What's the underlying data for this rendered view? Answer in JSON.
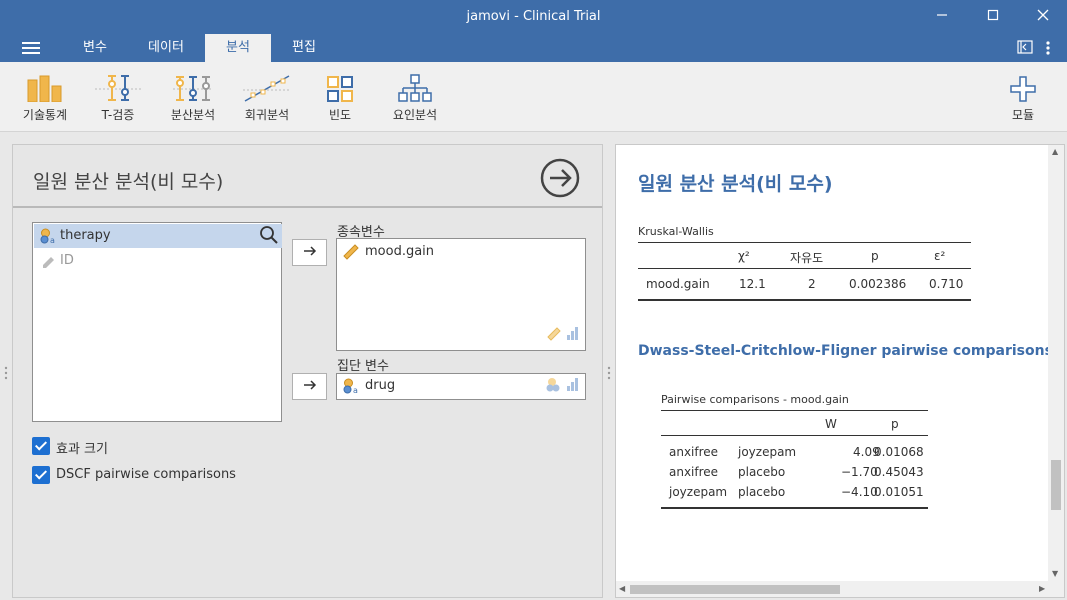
{
  "window": {
    "title": "jamovi - Clinical Trial"
  },
  "menu": {
    "tabs": [
      {
        "label": "변수"
      },
      {
        "label": "데이터"
      },
      {
        "label": "분석"
      },
      {
        "label": "편집"
      }
    ],
    "active_tab": "분석"
  },
  "ribbon": {
    "items": [
      {
        "label": "기술통계",
        "icon": "descriptives-icon"
      },
      {
        "label": "T-검증",
        "icon": "ttest-icon"
      },
      {
        "label": "분산분석",
        "icon": "anova-icon"
      },
      {
        "label": "회귀분석",
        "icon": "regression-icon"
      },
      {
        "label": "빈도",
        "icon": "frequencies-icon"
      },
      {
        "label": "요인분석",
        "icon": "factor-icon"
      }
    ],
    "modules_label": "모듈"
  },
  "analysis": {
    "title": "일원 분산 분석(비 모수)",
    "variables": [
      "therapy",
      "ID"
    ],
    "dependent_label": "종속변수",
    "dependent_value": "mood.gain",
    "grouping_label": "집단 변수",
    "grouping_value": "drug",
    "options": [
      {
        "label": "효과 크기",
        "checked": true
      },
      {
        "label": "DSCF pairwise comparisons",
        "checked": true
      }
    ]
  },
  "results": {
    "title": "일원 분산 분석(비 모수)",
    "kw": {
      "caption": "Kruskal-Wallis",
      "headers": [
        "χ²",
        "자유도",
        "p",
        "ε²"
      ],
      "row": {
        "name": "mood.gain",
        "chi": "12.1",
        "df": "2",
        "p": "0.002386",
        "eps": "0.710"
      }
    },
    "dscf": {
      "heading": "Dwass-Steel-Critchlow-Fligner pairwise comparisons",
      "caption": "Pairwise comparisons - mood.gain",
      "headers": [
        "W",
        "p"
      ],
      "rows": [
        {
          "a": "anxifree",
          "b": "joyzepam",
          "w": "4.09",
          "p": "0.01068"
        },
        {
          "a": "anxifree",
          "b": "placebo",
          "w": "−1.70",
          "p": "0.45043"
        },
        {
          "a": "joyzepam",
          "b": "placebo",
          "w": "−4.10",
          "p": "0.01051"
        }
      ]
    }
  },
  "colors": {
    "brand": "#3e6da9",
    "accent": "#1d6fd1",
    "selection": "#c5d6ec"
  }
}
